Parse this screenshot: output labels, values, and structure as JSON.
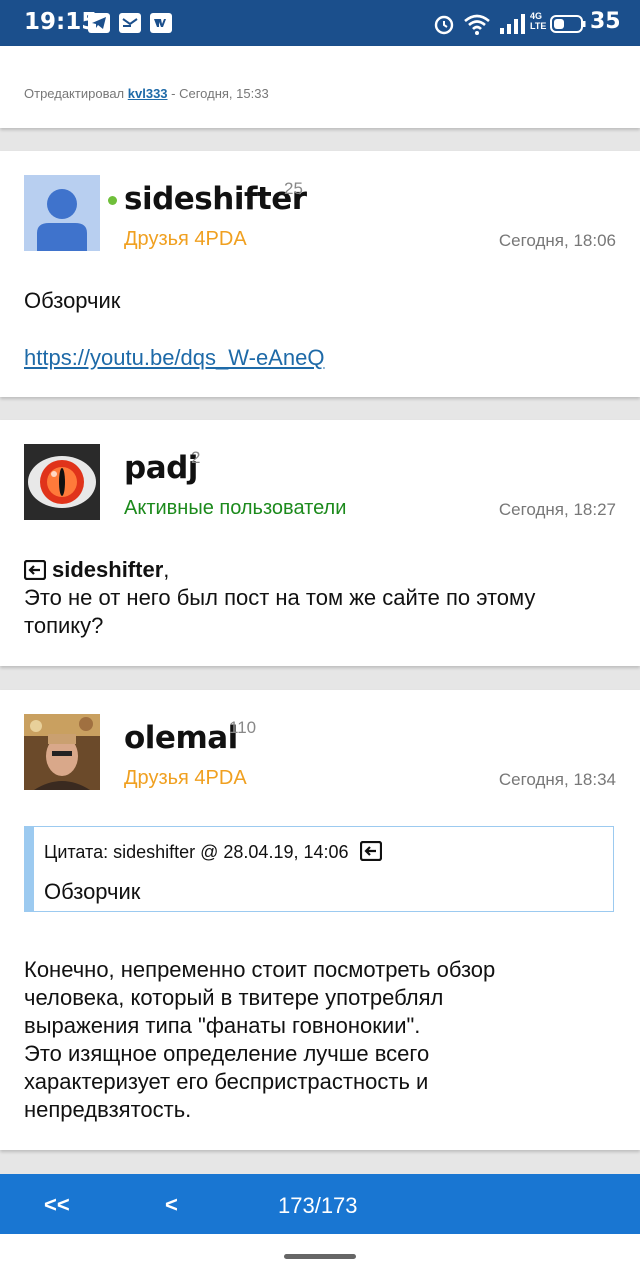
{
  "status_bar": {
    "time": "19:15",
    "left_icons": [
      "telegram-icon",
      "mail-icon",
      "vk-icon"
    ],
    "right_icons": [
      "alarm-icon",
      "wifi-icon",
      "signal-icon",
      "lte-icon",
      "battery-icon"
    ],
    "network": "4G",
    "battery": "35"
  },
  "top_post": {
    "edited_prefix": "Отредактировал",
    "edited_user": "kvl333",
    "edited_suffix": "- Сегодня, 15:33"
  },
  "posts": [
    {
      "username": "sideshifter",
      "reputation": "25",
      "online": true,
      "group": "Друзья 4PDA",
      "time": "Сегодня, 18:06",
      "text": "Обзорчик",
      "link": "https://youtu.be/dqs_W-eAneQ"
    },
    {
      "username": "padj",
      "reputation": "2",
      "group": "Активные пользователи",
      "time": "Сегодня, 18:27",
      "reply_to": "sideshifter",
      "reply_comma": ",",
      "text_line1": "Это не от него был пост на том же сайте по этому",
      "text_line2": "топику?"
    },
    {
      "username": "olemal",
      "reputation": "110",
      "group": "Друзья 4PDA",
      "time": "Сегодня, 18:34",
      "quote_header": "Цитата: sideshifter @ 28.04.19, 14:06",
      "quote_text": "Обзорчик",
      "lines": [
        "Конечно, непременно стоит посмотреть обзор",
        "человека, который в твитере употреблял",
        "выражения типа \"фанаты говнонокии\".",
        "Это изящное определение лучше всего",
        "характеризует его беспристрастность и",
        "непредвзятость."
      ]
    }
  ],
  "bottom_nav": {
    "first": "<<",
    "prev": "<",
    "page": "173/173"
  },
  "colors": {
    "status_bar": "#1b4f8c",
    "bottom_bar": "#1976d2",
    "friends_group": "#f0a020",
    "active_group": "#1c8a1c",
    "link": "#1e6aa8",
    "quote_border": "#9ccaf0"
  }
}
